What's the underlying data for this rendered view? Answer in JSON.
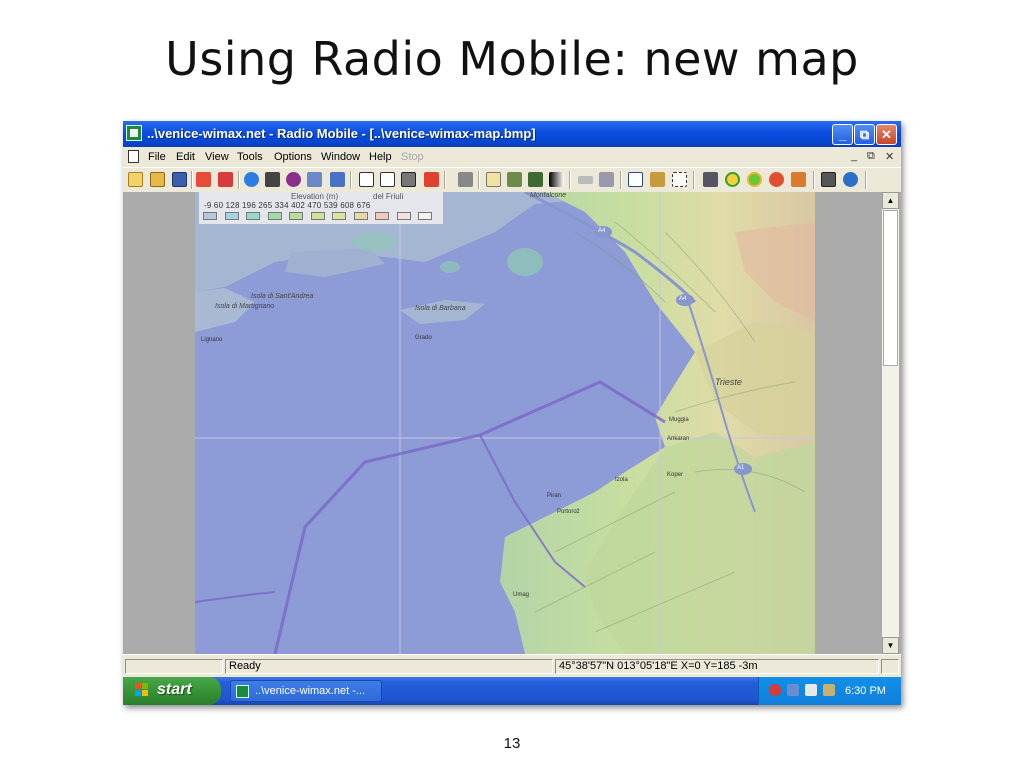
{
  "slide": {
    "title": "Using Radio Mobile: new map",
    "page_number": "13"
  },
  "window": {
    "title": "..\\venice-wimax.net - Radio Mobile - [..\\venice-wimax-map.bmp]",
    "controls": {
      "minimize": "_",
      "maximize": "⧉",
      "close": "✕"
    }
  },
  "menu": {
    "items": [
      "File",
      "Edit",
      "View",
      "Tools",
      "Options",
      "Window",
      "Help",
      "Stop"
    ],
    "mdi_controls": [
      "_",
      "⧉",
      "✕"
    ]
  },
  "toolbar": {
    "tools": [
      "new-map-icon",
      "open-icon",
      "save-icon",
      "network-properties-icon",
      "unit-properties-icon",
      "world-icon",
      "elevation-grid-icon",
      "radio-link-icon",
      "back-arrow-icon",
      "forward-arrow-icon",
      "copy-icon",
      "paste-icon",
      "save-image-icon",
      "print-picture-icon",
      "print-icon",
      "copy-image-icon",
      "merge-icon",
      "terrain-icon",
      "gray-scale-icon",
      "ruler-icon",
      "map-properties-icon",
      "table-icon",
      "unit-icon",
      "zoom-frame-icon",
      "antenna-icon",
      "coverage-icon",
      "combined-coverage-icon",
      "polar-icon",
      "network-icon",
      "map-icon",
      "globe-icon"
    ]
  },
  "legend": {
    "elevation_title": "Elevation (m)",
    "network_title": "del Friuli",
    "ticks": "-9   60  128  196  265  334  402  470  539  608  676",
    "colors": [
      "#b9c8dc",
      "#a5d2e2",
      "#9bd8cd",
      "#a3dcaa",
      "#b6e19b",
      "#cce59b",
      "#dee4a0",
      "#ead8a8",
      "#f0cbc0",
      "#f0e0e0",
      "#f4f4f4"
    ]
  },
  "map": {
    "labels": [
      "Monfalcone",
      "Isola di Sant'Andrea",
      "Isola di Martignano",
      "Lignano",
      "Isola di Barbana",
      "Grado",
      "Trieste",
      "Muggia",
      "Ankaran",
      "Izola",
      "Koper",
      "Piran",
      "Portorož",
      "Umag"
    ],
    "road_badges": [
      "A4",
      "A4",
      "A1"
    ]
  },
  "status": {
    "left": "",
    "ready": "Ready",
    "blank": "",
    "coordinates": "45°38'57\"N 013°05'18\"E  X=0 Y=185 -3m"
  },
  "taskbar": {
    "start": "start",
    "task_label": "..\\venice-wimax.net -...",
    "clock": "6:30 PM"
  },
  "colors": {
    "titlebar": "#0a4ee0",
    "sea": "#8d9bd6",
    "land": "#a7bbd2",
    "start_green": "#379337",
    "taskbar_blue": "#245edc"
  }
}
